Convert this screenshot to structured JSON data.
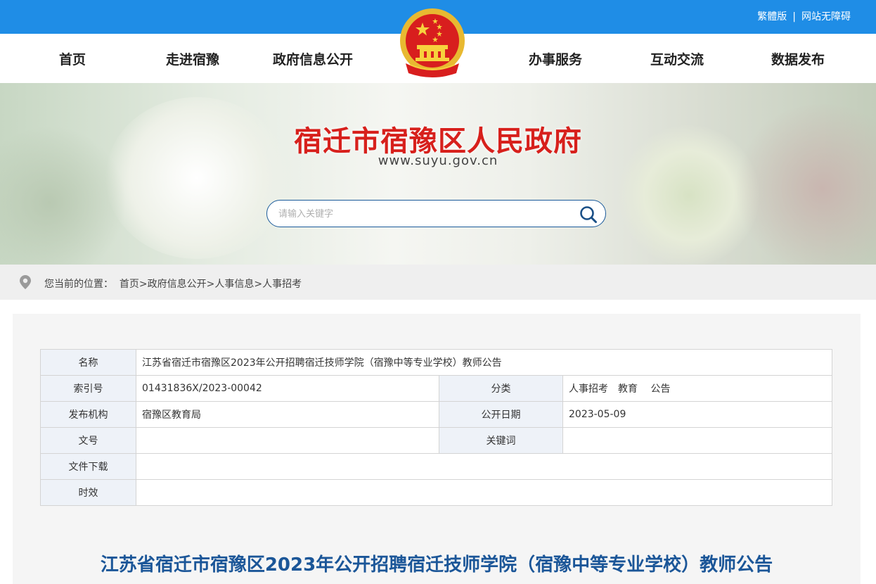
{
  "topbar": {
    "traditional": "繁體版",
    "separator": "|",
    "accessibility": "网站无障碍"
  },
  "nav": {
    "items": [
      "首页",
      "走进宿豫",
      "政府信息公开",
      "办事服务",
      "互动交流",
      "数据发布"
    ]
  },
  "banner": {
    "title": "宿迁市宿豫区人民政府",
    "url": "www.suyu.gov.cn"
  },
  "search": {
    "placeholder": "请输入关键字"
  },
  "breadcrumb": {
    "prefix": "您当前的位置：",
    "items": [
      "首页",
      "政府信息公开",
      "人事信息",
      "人事招考"
    ],
    "separator": ">"
  },
  "meta": {
    "name_label": "名称",
    "name_value": "江苏省宿迁市宿豫区2023年公开招聘宿迁技师学院（宿豫中等专业学校）教师公告",
    "index_label": "索引号",
    "index_value": "01431836X/2023-00042",
    "category_label": "分类",
    "category_value": "人事招考　教育　 公告",
    "org_label": "发布机构",
    "org_value": "宿豫区教育局",
    "date_label": "公开日期",
    "date_value": "2023-05-09",
    "docno_label": "文号",
    "docno_value": "",
    "keywords_label": "关键词",
    "keywords_value": "",
    "download_label": "文件下载",
    "download_value": "",
    "validity_label": "时效",
    "validity_value": ""
  },
  "article": {
    "title": "江苏省宿迁市宿豫区2023年公开招聘宿迁技师学院（宿豫中等专业学校）教师公告"
  },
  "colors": {
    "topbar": "#1f8de6",
    "title_red": "#d7201c",
    "article_blue": "#1b5698"
  }
}
